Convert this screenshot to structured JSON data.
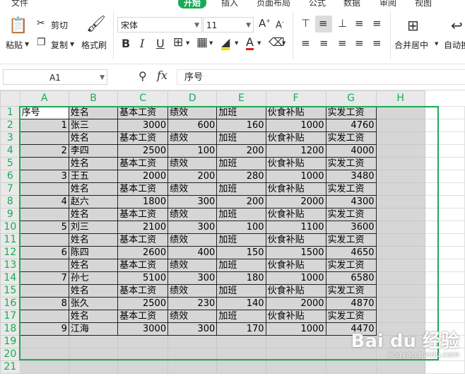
{
  "menu": {
    "items": [
      "文件",
      "开始",
      "插入",
      "页面布局",
      "公式",
      "数据",
      "审阅",
      "视图"
    ],
    "active": "开始"
  },
  "ribbon": {
    "paste": "粘贴",
    "cut": "剪切",
    "copy": "复制",
    "format_painter": "格式刷",
    "font_name": "宋体",
    "font_size": "11",
    "merge_center": "合并居中",
    "auto_wrap": "自动换"
  },
  "formula_bar": {
    "cell_ref": "A1",
    "fx": "fx",
    "content": "序号"
  },
  "columns": [
    "A",
    "B",
    "C",
    "D",
    "E",
    "F",
    "G",
    "H"
  ],
  "rows": [
    [
      "序号",
      "姓名",
      "基本工资",
      "绩效",
      "加班",
      "伙食补贴",
      "实发工资"
    ],
    [
      "1",
      "张三",
      "3000",
      "600",
      "160",
      "1000",
      "4760"
    ],
    [
      "",
      "姓名",
      "基本工资",
      "绩效",
      "加班",
      "伙食补贴",
      "实发工资"
    ],
    [
      "2",
      "李四",
      "2500",
      "100",
      "200",
      "1200",
      "4000"
    ],
    [
      "",
      "姓名",
      "基本工资",
      "绩效",
      "加班",
      "伙食补贴",
      "实发工资"
    ],
    [
      "3",
      "王五",
      "2000",
      "200",
      "280",
      "1000",
      "3480"
    ],
    [
      "",
      "姓名",
      "基本工资",
      "绩效",
      "加班",
      "伙食补贴",
      "实发工资"
    ],
    [
      "4",
      "赵六",
      "1800",
      "300",
      "200",
      "2000",
      "4300"
    ],
    [
      "",
      "姓名",
      "基本工资",
      "绩效",
      "加班",
      "伙食补贴",
      "实发工资"
    ],
    [
      "5",
      "刘三",
      "2100",
      "300",
      "100",
      "1100",
      "3600"
    ],
    [
      "",
      "姓名",
      "基本工资",
      "绩效",
      "加班",
      "伙食补贴",
      "实发工资"
    ],
    [
      "6",
      "陈四",
      "2600",
      "400",
      "150",
      "1500",
      "4650"
    ],
    [
      "",
      "姓名",
      "基本工资",
      "绩效",
      "加班",
      "伙食补贴",
      "实发工资"
    ],
    [
      "7",
      "孙七",
      "5100",
      "300",
      "180",
      "1000",
      "6580"
    ],
    [
      "",
      "姓名",
      "基本工资",
      "绩效",
      "加班",
      "伙食补贴",
      "实发工资"
    ],
    [
      "8",
      "张久",
      "2500",
      "230",
      "140",
      "2000",
      "4870"
    ],
    [
      "",
      "姓名",
      "基本工资",
      "绩效",
      "加班",
      "伙食补贴",
      "实发工资"
    ],
    [
      "9",
      "江海",
      "3000",
      "300",
      "170",
      "1000",
      "4470"
    ],
    [
      "",
      "",
      "",
      "",
      "",
      "",
      ""
    ],
    [
      "",
      "",
      "",
      "",
      "",
      "",
      ""
    ],
    [
      "",
      "",
      "",
      "",
      "",
      "",
      ""
    ]
  ],
  "watermark": {
    "text": "Bai du 经验",
    "sub": "jingyan.baidu.com"
  },
  "colors": {
    "accent": "#1aaa55",
    "selection_fill": "#d6d6d6"
  }
}
